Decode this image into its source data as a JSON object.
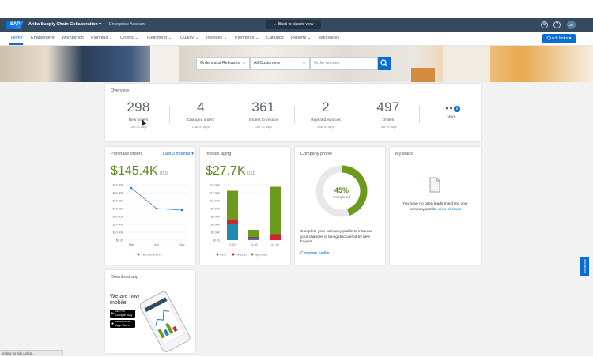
{
  "topbar": {
    "logo": "SAP",
    "app_name": "Ariba Supply Chain Collaboration",
    "app_chevron": "▾",
    "account": "Enterprise Account",
    "back_classic": "Back to classic view",
    "avatar": "JG"
  },
  "nav": {
    "items": [
      "Home",
      "Enablement",
      "Workbench",
      "Planning",
      "Orders",
      "Fulfillment",
      "Quality",
      "Invoices",
      "Payments",
      "Catalogs",
      "Reports",
      "Messages"
    ],
    "dropdown_flags": [
      false,
      false,
      false,
      true,
      true,
      true,
      true,
      true,
      true,
      false,
      true,
      false
    ],
    "quick_links": "Quick links"
  },
  "search": {
    "type": "Orders and Releases",
    "customers": "All Customers",
    "placeholder": "Order number"
  },
  "overview": {
    "title": "Overview",
    "items": [
      {
        "value": "298",
        "label": "New orders",
        "sub": "Last 90 days"
      },
      {
        "value": "4",
        "label": "Changed orders",
        "sub": "Last 90 days"
      },
      {
        "value": "361",
        "label": "Orders to invoice",
        "sub": "Last 90 days"
      },
      {
        "value": "2",
        "label": "Rejected invoices",
        "sub": "Last 90 days"
      },
      {
        "value": "497",
        "label": "Orders",
        "sub": "Last 90 days"
      }
    ],
    "more_label": "More",
    "more_badge": "6"
  },
  "purchase_orders": {
    "title": "Purchase orders",
    "period": "Last 3 months ▾",
    "amount": "$145.4K",
    "currency": "USD",
    "legend": "All Customers"
  },
  "invoice_aging": {
    "title": "Invoice aging",
    "amount": "$27.7K",
    "currency": "USD",
    "legend": [
      "Sent",
      "Rejected",
      "Approved"
    ]
  },
  "company_profile": {
    "title": "Company profile",
    "percent": "45%",
    "completed": "Completed",
    "progress": 0.45,
    "text": "Complete your company profile to increase your chances of being discovered by new buyers.",
    "link": "Complete profile →"
  },
  "my_leads": {
    "title": "My leads",
    "text": "You have no open leads matching your company profile.",
    "link": "View all leads"
  },
  "download_app": {
    "title": "Download app",
    "line1": "We are now",
    "line2": "mobile.",
    "google_small": "GET IT ON",
    "google": "Google play",
    "apple_small": "Download on the",
    "apple": "App Store"
  },
  "feedback": "Feedback",
  "status_text": "tecting for sdk.uplicp...",
  "colors": {
    "accent": "#0a6ed1",
    "amount_green": "#5b8a1c",
    "sent": "#1f8ab5",
    "rejected": "#d2242c",
    "approved": "#6b9a1f",
    "line": "#2a7fc1"
  },
  "chart_data": [
    {
      "type": "line",
      "title": "Purchase orders",
      "x": [
        "Mar",
        "Apr",
        "May"
      ],
      "series": [
        {
          "name": "All Customers",
          "values": [
            66,
            40,
            38
          ]
        }
      ],
      "ylabel": "",
      "yticks": [
        "$0.00",
        "$10.00K",
        "$20.00K",
        "$30.00K",
        "$40.00K",
        "$50.00K",
        "$60.00K",
        "$70.00K"
      ],
      "ylim": [
        0,
        70
      ],
      "unit": "$K"
    },
    {
      "type": "bar",
      "title": "Invoice aging",
      "categories": [
        "0-30",
        "31-60",
        "61-90"
      ],
      "series": [
        {
          "name": "Sent",
          "values": [
            4.0,
            0.5,
            0.0
          ]
        },
        {
          "name": "Rejected",
          "values": [
            1.0,
            0.3,
            1.5
          ]
        },
        {
          "name": "Approved",
          "values": [
            7.5,
            1.8,
            12.0
          ]
        }
      ],
      "yticks": [
        "$0.00",
        "$2.00K",
        "$4.00K",
        "$6.00K",
        "$8.00K",
        "$10.00K",
        "$12.00K",
        "$14.00K"
      ],
      "ylim": [
        0,
        14
      ],
      "unit": "$K"
    }
  ]
}
